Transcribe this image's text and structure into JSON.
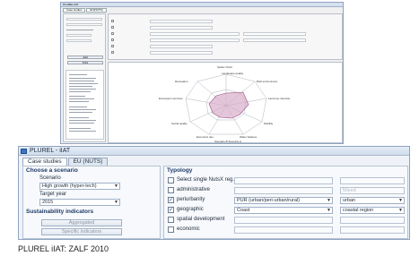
{
  "thumbnail": {
    "title": "PLUREL iIAT",
    "tabs": [
      "Case studies",
      "EU(NUTS)"
    ],
    "left_buttons": [
      "Add",
      "Print"
    ],
    "chart_title": "Spider Chart",
    "chart_legend": "Scenario B  Scenario A",
    "chart_axes": [
      "Landscape quality",
      "Built environment",
      "Land use intensity",
      "Mobility",
      "Water balance",
      "Economic dev.",
      "Social quality",
      "Ecosystem services",
      "Recreation",
      "Biodiversity"
    ]
  },
  "window": {
    "title": "PLUREL - iIAT",
    "tabs": [
      {
        "label": "Case studies",
        "active": true
      },
      {
        "label": "EU (NUTS)",
        "active": false
      }
    ]
  },
  "left_panel": {
    "section_title": "Choose a scenario",
    "scenario_label": "Scenario",
    "scenario_value": "High growth (hyper-tech)",
    "target_year_label": "Target year",
    "target_year_value": "2015",
    "indicators_title": "Sustainability indicators",
    "aggregated_label": "Aggregated",
    "specific_label": "Specific indicators"
  },
  "right_panel": {
    "section_title": "Typology",
    "rows": [
      {
        "label": "Select single NutsX reg...",
        "checked": false,
        "value": "",
        "value2": ""
      },
      {
        "label": "administrative",
        "checked": false,
        "value": "",
        "value2": "Mixed"
      },
      {
        "label": "periurbanity",
        "checked": true,
        "value": "PUR (urban/peri-urban/rural)",
        "value2": "urban"
      },
      {
        "label": "geographic",
        "checked": true,
        "value": "Coast",
        "value2": "coastal region"
      },
      {
        "label": "spatial development",
        "checked": false,
        "value": "",
        "value2": ""
      },
      {
        "label": "economic",
        "checked": false,
        "value": "",
        "value2": ""
      }
    ]
  },
  "caption": "PLUREL iIAT: ZALF 2010",
  "colors": {
    "accent": "#3b73c4",
    "spider_fill": "#d6a8c6",
    "spider_stroke": "#9a4f82"
  },
  "icons": {
    "window": "app-icon",
    "check": "check-icon",
    "dropdown": "chevron-down-icon"
  }
}
